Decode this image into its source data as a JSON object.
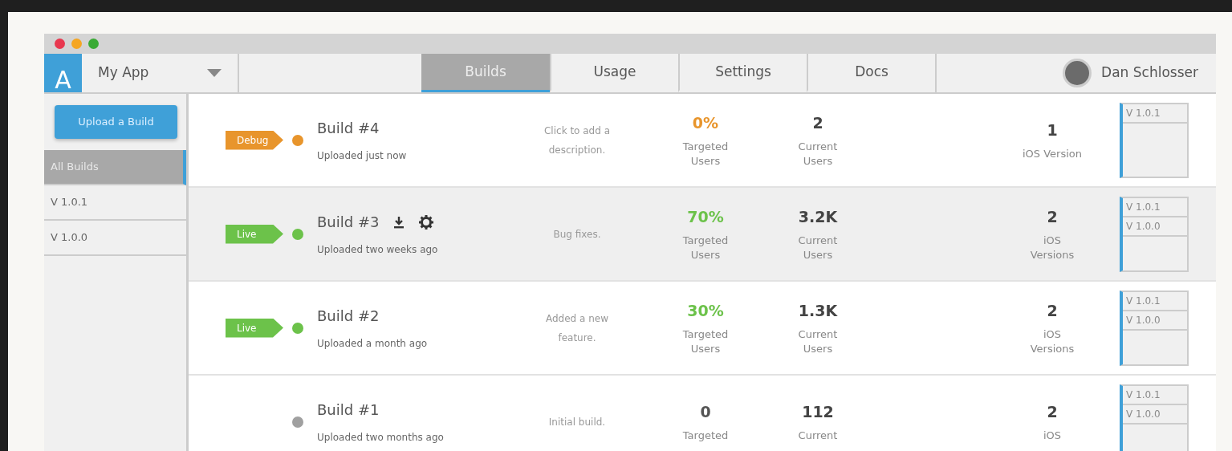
{
  "logo": "A",
  "app_selector": {
    "label": "My App"
  },
  "tabs": [
    {
      "label": "Builds",
      "selected": true
    },
    {
      "label": "Usage",
      "selected": false
    },
    {
      "label": "Settings",
      "selected": false
    },
    {
      "label": "Docs",
      "selected": false
    }
  ],
  "user": {
    "name": "Dan Schlosser"
  },
  "sidebar": {
    "upload_button": "Upload a Build",
    "items": [
      {
        "label": "All Builds",
        "selected": true
      },
      {
        "label": "V 1.0.1",
        "selected": false
      },
      {
        "label": "V 1.0.0",
        "selected": false
      }
    ]
  },
  "builds": [
    {
      "kind": "debug",
      "tag": "Debug",
      "title": "Build #4",
      "actions": false,
      "uploaded": "Uploaded just now",
      "description": "Click to add a description.",
      "targeted": "0%",
      "targeted_label": "Targeted Users",
      "current": "2",
      "current_label": "Current Users",
      "ios": "1",
      "ios_label": "iOS Version",
      "versions": [
        "V 1.0.1"
      ],
      "selected": false
    },
    {
      "kind": "live",
      "tag": "Live",
      "title": "Build #3",
      "actions": true,
      "uploaded": "Uploaded two weeks ago",
      "description": "Bug fixes.",
      "targeted": "70%",
      "targeted_label": "Targeted Users",
      "current": "3.2K",
      "current_label": "Current Users",
      "ios": "2",
      "ios_label": "iOS Versions",
      "versions": [
        "V 1.0.1",
        "V 1.0.0"
      ],
      "selected": true
    },
    {
      "kind": "live",
      "tag": "Live",
      "title": "Build #2",
      "actions": false,
      "uploaded": "Uploaded a month ago",
      "description": "Added a new feature.",
      "targeted": "30%",
      "targeted_label": "Targeted Users",
      "current": "1.3K",
      "current_label": "Current Users",
      "ios": "2",
      "ios_label": "iOS Versions",
      "versions": [
        "V 1.0.1",
        "V 1.0.0"
      ],
      "selected": false
    },
    {
      "kind": "none",
      "title": "Build #1",
      "actions": false,
      "uploaded": "Uploaded two months ago",
      "description": "Initial build.",
      "targeted": "0",
      "targeted_label": "Targeted",
      "current": "112",
      "current_label": "Current",
      "ios": "2",
      "ios_label": "iOS",
      "versions": [
        "V 1.0.1",
        "V 1.0.0"
      ],
      "selected": false
    }
  ]
}
